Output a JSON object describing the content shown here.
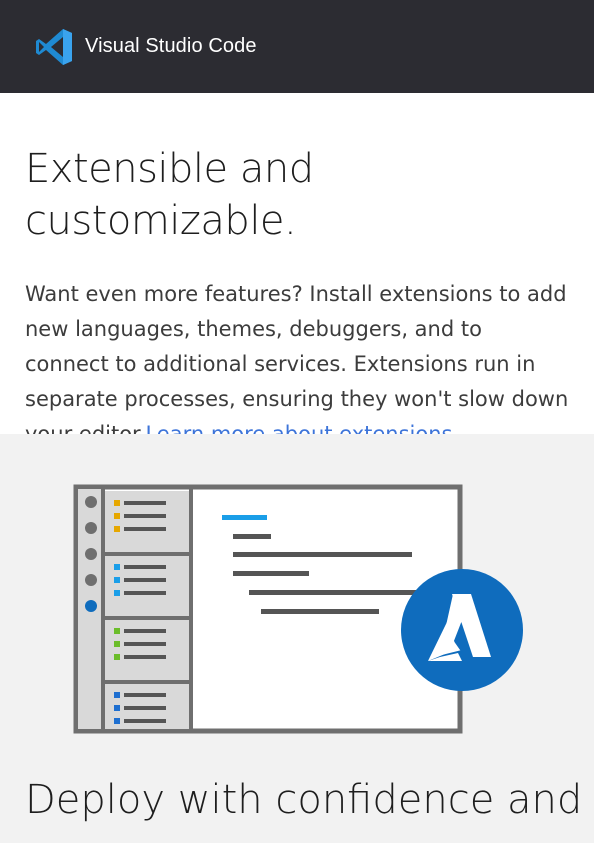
{
  "header": {
    "brand": "Visual Studio Code",
    "logo_icon": "vscode-logo-icon",
    "background": "#2c2c32"
  },
  "feature": {
    "title": "Extensible and customizable.",
    "body": "Want even more features? Install extensions to add new languages, themes, debuggers, and to connect to additional services. Extensions run in separate processes, ensuring they won't slow down your editor.",
    "link_text": "Learn more about extensions.",
    "link_color": "#3d74d9"
  },
  "illustration": {
    "badge_icon": "azure-icon",
    "badge_color": "#0f6cbd"
  },
  "next_section": {
    "title": "Deploy with confidence and"
  }
}
